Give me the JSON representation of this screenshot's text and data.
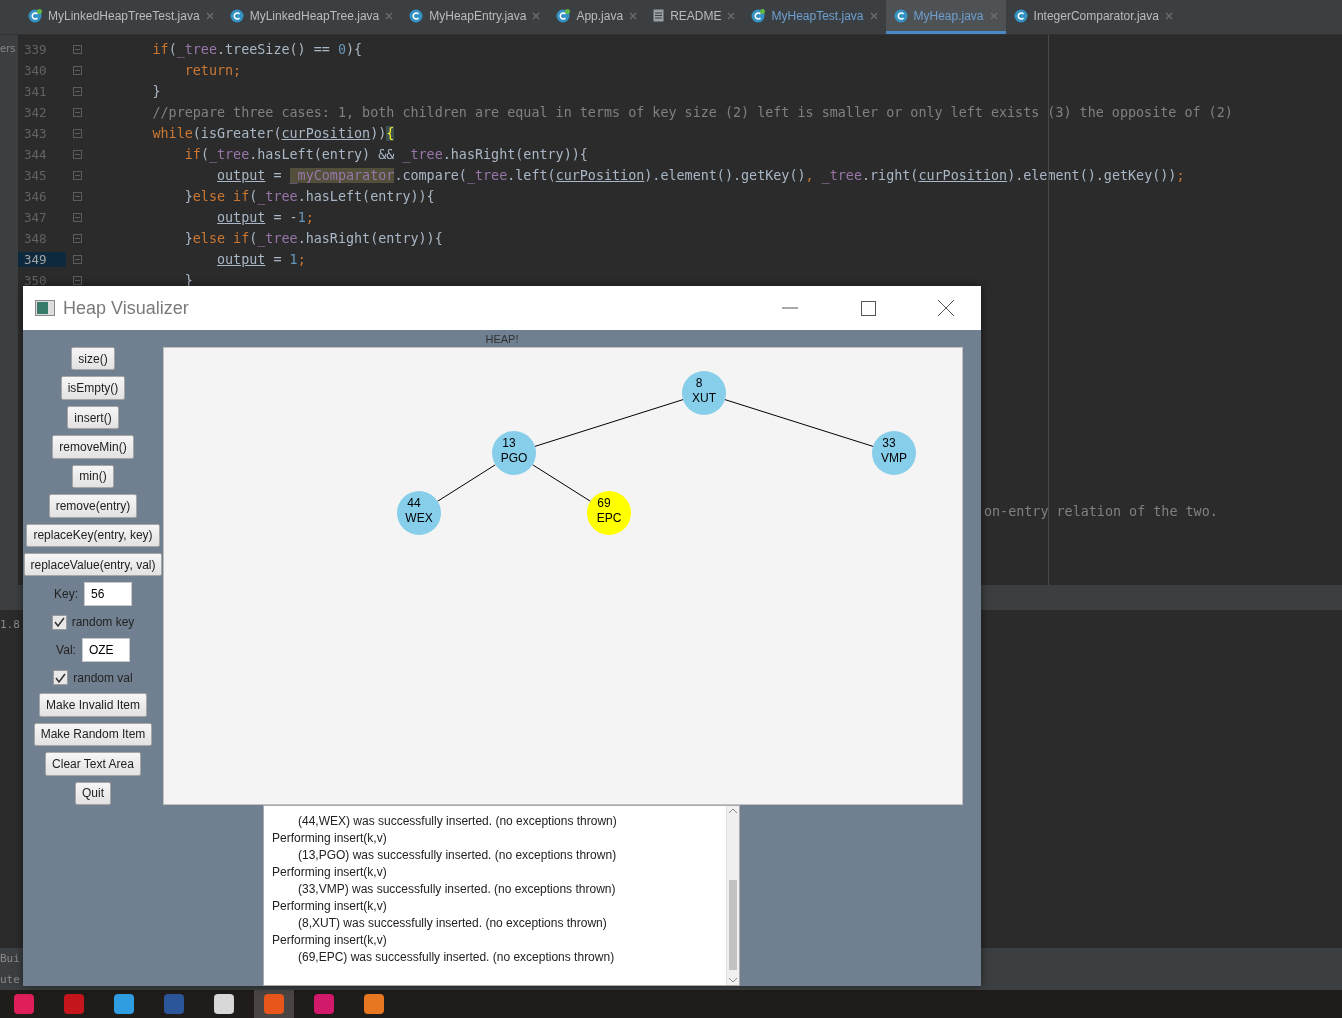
{
  "tabs": [
    {
      "label": "MyLinkedHeapTreeTest.java",
      "kind": "test",
      "selected": false,
      "modified": false
    },
    {
      "label": "MyLinkedHeapTree.java",
      "kind": "class",
      "selected": false,
      "modified": false
    },
    {
      "label": "MyHeapEntry.java",
      "kind": "class",
      "selected": false,
      "modified": false
    },
    {
      "label": "App.java",
      "kind": "test",
      "selected": false,
      "modified": false
    },
    {
      "label": "README",
      "kind": "doc",
      "selected": false,
      "modified": false
    },
    {
      "label": "MyHeapTest.java",
      "kind": "test",
      "selected": false,
      "modified": true
    },
    {
      "label": "MyHeap.java",
      "kind": "class",
      "selected": true,
      "modified": true
    },
    {
      "label": "IntegerComparator.java",
      "kind": "class",
      "selected": false,
      "modified": false
    }
  ],
  "side_label": "ers",
  "editor": {
    "lines": [
      {
        "number": "339",
        "current": false,
        "tokens": [
          {
            "kind": "kw",
            "text": "        if"
          },
          {
            "kind": "plain",
            "text": "("
          },
          {
            "kind": "field",
            "text": "_tree"
          },
          {
            "kind": "plain",
            "text": ".treeSize() == "
          },
          {
            "kind": "num",
            "text": "0"
          },
          {
            "kind": "plain",
            "text": "){"
          }
        ]
      },
      {
        "number": "340",
        "current": false,
        "tokens": [
          {
            "kind": "kw",
            "text": "            return;"
          }
        ]
      },
      {
        "number": "341",
        "current": false,
        "tokens": [
          {
            "kind": "plain",
            "text": "        }"
          }
        ]
      },
      {
        "number": "342",
        "current": false,
        "tokens": [
          {
            "kind": "comment",
            "text": "        //prepare three cases: 1, both children are equal in terms of key size (2) left is smaller or only left exists (3) the opposite of (2)"
          }
        ]
      },
      {
        "number": "343",
        "current": false,
        "tokens": [
          {
            "kind": "kw",
            "text": "        while"
          },
          {
            "kind": "plain",
            "text": "(isGreater("
          },
          {
            "kind": "var",
            "text": "curPosition"
          },
          {
            "kind": "plain",
            "text": "))"
          },
          {
            "kind": "brace",
            "text": "{"
          }
        ]
      },
      {
        "number": "344",
        "current": false,
        "tokens": [
          {
            "kind": "kw",
            "text": "            if"
          },
          {
            "kind": "plain",
            "text": "("
          },
          {
            "kind": "field",
            "text": "_tree"
          },
          {
            "kind": "plain",
            "text": ".hasLeft(entry) && "
          },
          {
            "kind": "field",
            "text": "_tree"
          },
          {
            "kind": "plain",
            "text": ".hasRight(entry)){"
          }
        ]
      },
      {
        "number": "345",
        "current": false,
        "tokens": [
          {
            "kind": "var",
            "text": "                output"
          },
          {
            "kind": "plain",
            "text": " = "
          },
          {
            "kind": "hl",
            "text": "_myComparator"
          },
          {
            "kind": "plain",
            "text": ".compare("
          },
          {
            "kind": "field",
            "text": "_tree"
          },
          {
            "kind": "plain",
            "text": ".left("
          },
          {
            "kind": "var",
            "text": "curPosition"
          },
          {
            "kind": "plain",
            "text": ").element().getKey()"
          },
          {
            "kind": "kw",
            "text": ", "
          },
          {
            "kind": "field",
            "text": "_tree"
          },
          {
            "kind": "plain",
            "text": ".right("
          },
          {
            "kind": "var",
            "text": "curPosition"
          },
          {
            "kind": "plain",
            "text": ").element().getKey())"
          },
          {
            "kind": "kw",
            "text": ";"
          }
        ]
      },
      {
        "number": "346",
        "current": false,
        "tokens": [
          {
            "kind": "plain",
            "text": "            }"
          },
          {
            "kind": "kw",
            "text": "else if"
          },
          {
            "kind": "plain",
            "text": "("
          },
          {
            "kind": "field",
            "text": "_tree"
          },
          {
            "kind": "plain",
            "text": ".hasLeft(entry)){"
          }
        ]
      },
      {
        "number": "347",
        "current": false,
        "tokens": [
          {
            "kind": "var",
            "text": "                output"
          },
          {
            "kind": "plain",
            "text": " = -"
          },
          {
            "kind": "num",
            "text": "1"
          },
          {
            "kind": "kw",
            "text": ";"
          }
        ]
      },
      {
        "number": "348",
        "current": false,
        "tokens": [
          {
            "kind": "plain",
            "text": "            }"
          },
          {
            "kind": "kw",
            "text": "else if"
          },
          {
            "kind": "plain",
            "text": "("
          },
          {
            "kind": "field",
            "text": "_tree"
          },
          {
            "kind": "plain",
            "text": ".hasRight(entry)){"
          }
        ]
      },
      {
        "number": "349",
        "current": true,
        "tokens": [
          {
            "kind": "var",
            "text": "                output"
          },
          {
            "kind": "plain",
            "text": " = "
          },
          {
            "kind": "num",
            "text": "1"
          },
          {
            "kind": "kw",
            "text": ";"
          }
        ]
      },
      {
        "number": "350",
        "current": false,
        "tokens": [
          {
            "kind": "plain",
            "text": "            }"
          }
        ]
      }
    ],
    "right_fragment": "on-entry relation of the two."
  },
  "panel_fragments": [
    "1.8",
    "Bui",
    "ute"
  ],
  "window": {
    "title": "Heap Visualizer",
    "heading": "HEAP!",
    "controls": [
      {
        "kind": "button",
        "label": "size()"
      },
      {
        "kind": "button",
        "label": "isEmpty()"
      },
      {
        "kind": "button",
        "label": "insert()"
      },
      {
        "kind": "button",
        "label": "removeMin()"
      },
      {
        "kind": "button",
        "label": "min()"
      },
      {
        "kind": "button",
        "label": "remove(entry)"
      },
      {
        "kind": "button",
        "label": "replaceKey(entry, key)"
      },
      {
        "kind": "button",
        "label": "replaceValue(entry, val)"
      },
      {
        "kind": "field",
        "label": "Key:",
        "value": "56"
      },
      {
        "kind": "checkbox",
        "label": "random key",
        "checked": true
      },
      {
        "kind": "field",
        "label": "Val:",
        "value": "OZE"
      },
      {
        "kind": "checkbox",
        "label": "random val",
        "checked": true
      },
      {
        "kind": "button",
        "label": "Make Invalid Item"
      },
      {
        "kind": "button",
        "label": "Make Random Item"
      },
      {
        "kind": "button",
        "label": "Clear Text Area"
      },
      {
        "kind": "button",
        "label": "Quit"
      }
    ],
    "tree": {
      "key": "8",
      "value": "XUT",
      "color": "#87ceeb",
      "children": [
        {
          "key": "13",
          "value": "PGO",
          "color": "#87ceeb",
          "children": [
            {
              "key": "44",
              "value": "WEX",
              "color": "#87ceeb"
            },
            {
              "key": "69",
              "value": "EPC",
              "color": "#ffff00"
            }
          ]
        },
        {
          "key": "33",
          "value": "VMP",
          "color": "#87ceeb"
        }
      ]
    },
    "log": [
      {
        "kind": "result",
        "text": "(44,WEX) was successfully inserted. (no exceptions thrown)"
      },
      {
        "kind": "action",
        "text": "Performing insert(k,v)"
      },
      {
        "kind": "result",
        "text": "(13,PGO) was successfully inserted. (no exceptions thrown)"
      },
      {
        "kind": "action",
        "text": "Performing insert(k,v)"
      },
      {
        "kind": "result",
        "text": "(33,VMP) was successfully inserted. (no exceptions thrown)"
      },
      {
        "kind": "action",
        "text": "Performing insert(k,v)"
      },
      {
        "kind": "result",
        "text": "(8,XUT) was successfully inserted. (no exceptions thrown)"
      },
      {
        "kind": "action",
        "text": "Performing insert(k,v)"
      },
      {
        "kind": "result",
        "text": "(69,EPC) was successfully inserted. (no exceptions thrown)"
      }
    ]
  },
  "taskbar": [
    {
      "color": "#e01e5a",
      "selected": false
    },
    {
      "color": "#c4161c",
      "selected": false
    },
    {
      "color": "#2f9ee0",
      "selected": false
    },
    {
      "color": "#2b579a",
      "selected": false
    },
    {
      "color": "#d8d8d8",
      "selected": false
    },
    {
      "color": "#e8561b",
      "selected": true
    },
    {
      "color": "#d31a6a",
      "selected": false
    },
    {
      "color": "#e87722",
      "selected": false
    }
  ]
}
